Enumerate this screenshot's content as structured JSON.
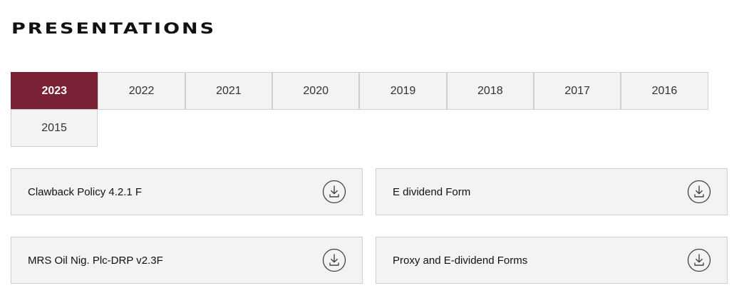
{
  "header": {
    "title": "PRESENTATIONS"
  },
  "year_tabs": {
    "active": "2023",
    "items": [
      {
        "label": "2023"
      },
      {
        "label": "2022"
      },
      {
        "label": "2021"
      },
      {
        "label": "2020"
      },
      {
        "label": "2019"
      },
      {
        "label": "2018"
      },
      {
        "label": "2017"
      },
      {
        "label": "2016"
      },
      {
        "label": "2015"
      }
    ]
  },
  "documents": [
    {
      "title": "Clawback Policy 4.2.1 F",
      "icon": "download-icon"
    },
    {
      "title": "E dividend Form",
      "icon": "download-icon"
    },
    {
      "title": "MRS Oil Nig. Plc-DRP v2.3F",
      "icon": "download-icon"
    },
    {
      "title": "Proxy and E-dividend Forms",
      "icon": "download-icon"
    }
  ],
  "colors": {
    "accent": "#7a2135",
    "tab_background": "#f3f3f3",
    "border": "#cfcfcf"
  }
}
